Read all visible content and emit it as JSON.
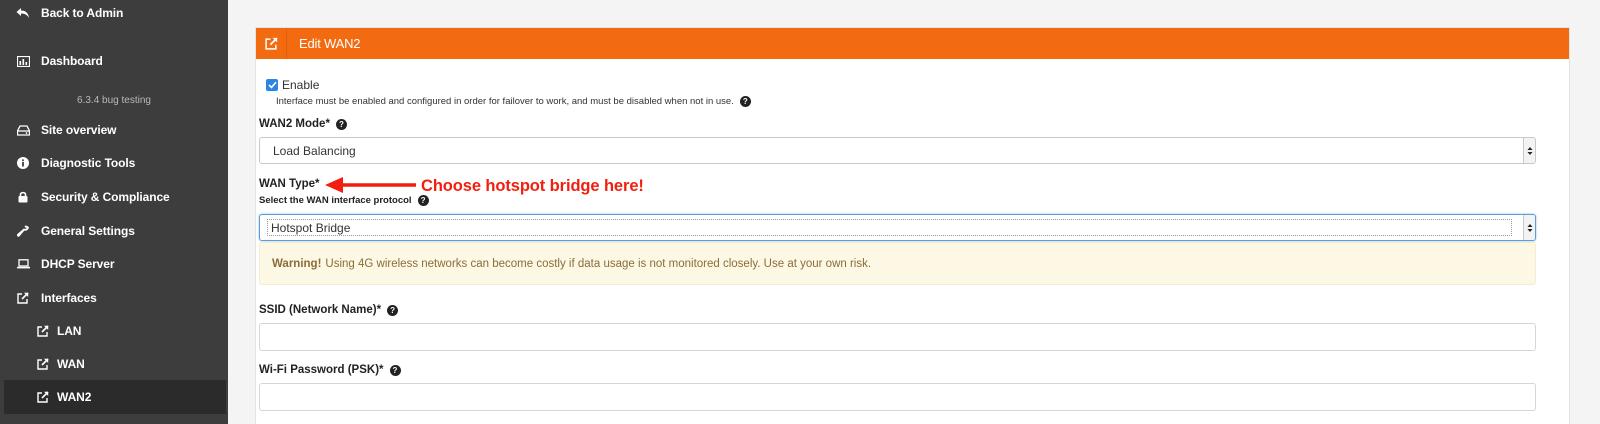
{
  "sidebar": {
    "back": "Back to Admin",
    "dashboard": "Dashboard",
    "version": "6.3.4 bug testing",
    "items": [
      {
        "label": "Site overview"
      },
      {
        "label": "Diagnostic Tools"
      },
      {
        "label": "Security & Compliance"
      },
      {
        "label": "General Settings"
      },
      {
        "label": "DHCP Server"
      },
      {
        "label": "Interfaces"
      }
    ],
    "sub_items": [
      {
        "label": "LAN"
      },
      {
        "label": "WAN"
      },
      {
        "label": "WAN2"
      }
    ],
    "active_item": "WAN2"
  },
  "panel": {
    "title": "Edit WAN2",
    "header_color": "#f26b11",
    "enable": {
      "label": "Enable",
      "checked": true,
      "help": "Interface must be enabled and configured in order for failover to work, and must be disabled when not in use."
    },
    "mode": {
      "label": "WAN2 Mode*",
      "value": "Load Balancing"
    },
    "wan_type": {
      "label": "WAN Type*",
      "sublabel": "Select the WAN interface protocol",
      "value": "Hotspot Bridge"
    },
    "warning": {
      "strong": "Warning!",
      "text": "Using 4G wireless networks can become costly if data usage is not monitored closely. Use at your own risk."
    },
    "ssid": {
      "label": "SSID (Network Name)*",
      "value": ""
    },
    "psk": {
      "label": "Wi-Fi Password (PSK)*",
      "value": ""
    }
  },
  "annotation": {
    "text": "Choose hotspot bridge here!",
    "color": "#f21f0f"
  }
}
